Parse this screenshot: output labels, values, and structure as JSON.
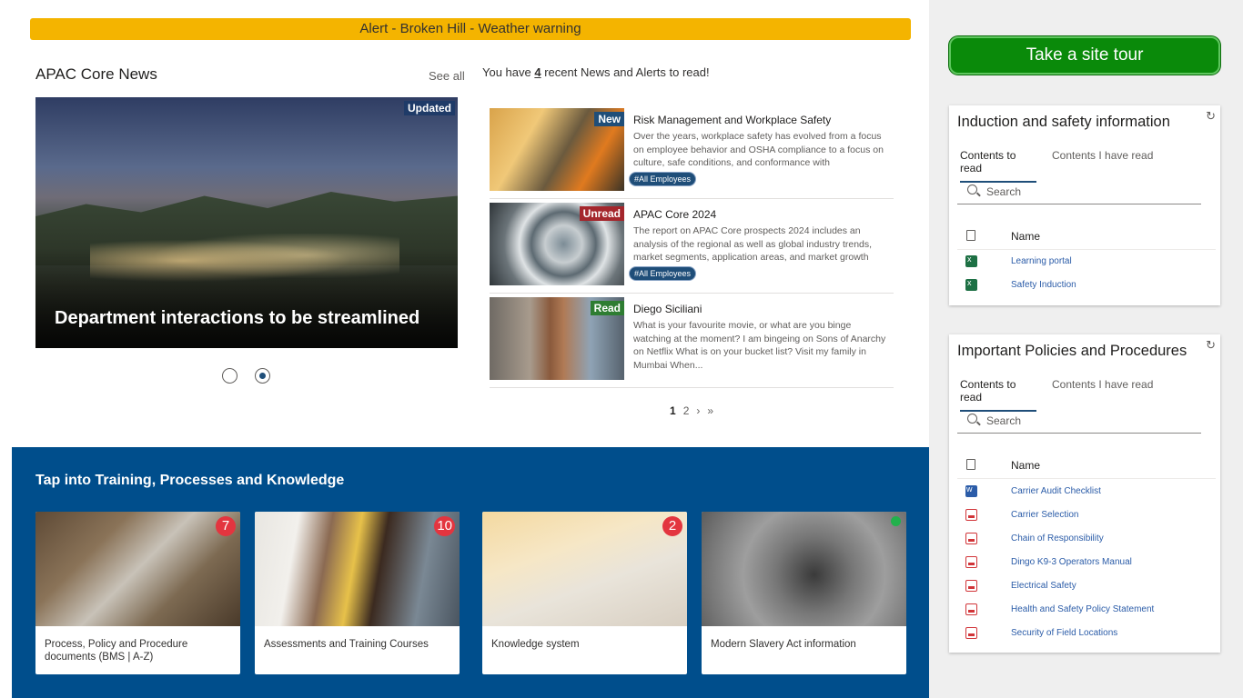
{
  "alert": {
    "text": "Alert - Broken Hill - Weather warning"
  },
  "news": {
    "title": "APAC Core News",
    "see_all": "See all",
    "hero": {
      "badge": "Updated",
      "caption": "Department interactions to be streamlined"
    },
    "recent_prefix": "You have ",
    "recent_count": "4",
    "recent_suffix": " recent News and Alerts to read!",
    "items": [
      {
        "status": "New",
        "status_color": "#1f4e79",
        "title": "Risk Management and Workplace Safety",
        "description": "Over the years, workplace safety has evolved from a focus on employee behavior and OSHA compliance to a focus on culture, safe conditions, and conformance with organization...",
        "tag": "#All Employees"
      },
      {
        "status": "Unread",
        "status_color": "#a4262c",
        "title": "APAC Core 2024",
        "description": "The report on APAC Core prospects 2024 includes an analysis of the regional as well as global industry trends, market segments, application areas, and market growth strategies...",
        "tag": "#All Employees"
      },
      {
        "status": "Read",
        "status_color": "#2e7d32",
        "title": "Diego Siciliani",
        "description": "What is your favourite movie, or what are you binge watching at the moment? I am bingeing on Sons of Anarchy on Netflix What is on your bucket list? Visit my family in Mumbai When...",
        "tag": ""
      }
    ],
    "pager": {
      "page1": "1",
      "page2": "2",
      "next": "›",
      "last": "»"
    }
  },
  "training": {
    "title": "Tap into Training, Processes and Knowledge",
    "tiles": [
      {
        "label": "Process, Policy and Procedure documents (BMS | A-Z)",
        "count": "7"
      },
      {
        "label": "Assessments and Training Courses",
        "count": "10"
      },
      {
        "label": "Knowledge system",
        "count": "2"
      },
      {
        "label": "Modern Slavery Act information",
        "count": ""
      }
    ]
  },
  "sidebar": {
    "tour_button": "Take a site tour",
    "induction": {
      "title": "Induction and safety information",
      "tab_active": "Contents to read",
      "tab_other": "Contents I have read",
      "search_placeholder": "Search",
      "column_name": "Name",
      "files": [
        {
          "name": "Learning portal",
          "icon": "excel-icon"
        },
        {
          "name": "Safety Induction",
          "icon": "excel-icon"
        }
      ]
    },
    "policies": {
      "title": "Important Policies and Procedures",
      "tab_active": "Contents to read",
      "tab_other": "Contents I have read",
      "search_placeholder": "Search",
      "column_name": "Name",
      "files": [
        {
          "name": "Carrier Audit Checklist",
          "icon": "word-icon"
        },
        {
          "name": "Carrier Selection",
          "icon": "pdf-icon"
        },
        {
          "name": "Chain of Responsibility",
          "icon": "pdf-icon"
        },
        {
          "name": "Dingo K9-3 Operators Manual",
          "icon": "pdf-icon"
        },
        {
          "name": "Electrical Safety",
          "icon": "pdf-icon"
        },
        {
          "name": "Health and Safety Policy Statement",
          "icon": "pdf-icon"
        },
        {
          "name": "Security of Field Locations",
          "icon": "pdf-icon"
        }
      ]
    }
  }
}
